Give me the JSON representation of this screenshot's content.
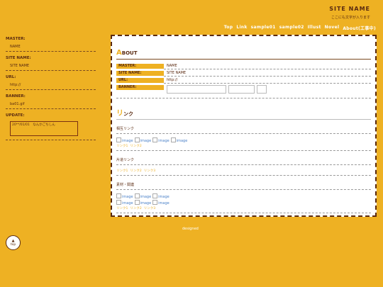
{
  "header": {
    "site_name": "SITE NAME",
    "subtitle": "ここにも文字が入ります"
  },
  "nav": [
    "Top",
    "Link",
    "sample01",
    "sample02",
    "Illust",
    "Novel",
    "About(工事中)"
  ],
  "sidebar": {
    "master_label": "MASTER:",
    "master_value": "NAME",
    "site_label": "SITE NAME:",
    "site_value": "SITE NAME",
    "url_label": "URL:",
    "url_value": "http://",
    "banner_label": "BANNER:",
    "banner_value": "ba01.gif",
    "update_label": "UPDATE:",
    "update_text": "20**/01/01　なんかごちしん"
  },
  "about": {
    "heading_cap": "A",
    "heading_rest": "BOUT",
    "rows": [
      {
        "k": "MASTER:",
        "v": "NAME"
      },
      {
        "k": "SITE NAME:",
        "v": "SITE NAME"
      },
      {
        "k": "URL:",
        "v": "http://"
      },
      {
        "k": "BANNER:",
        "v": ""
      }
    ]
  },
  "links": {
    "heading_cap": "リ",
    "heading_rest": "ンク",
    "mutual": {
      "title": "相互リンク",
      "images": [
        "image",
        "image",
        "image",
        "image"
      ],
      "texts": [
        "リンク1",
        "リンク2"
      ]
    },
    "oneway": {
      "title": "片道リンク",
      "texts": [
        "リンク1",
        "リンク2",
        "リンク3"
      ]
    },
    "material": {
      "title": "素材・関連",
      "images_row1": [
        "image",
        "image",
        "image"
      ],
      "images_row2": [
        "image",
        "image",
        "image"
      ],
      "texts": [
        "リンク1",
        "リンク2",
        "リンク3"
      ]
    }
  },
  "footer": {
    "designed": "designed",
    "top_label": "top",
    "top_arrow": "▲"
  }
}
